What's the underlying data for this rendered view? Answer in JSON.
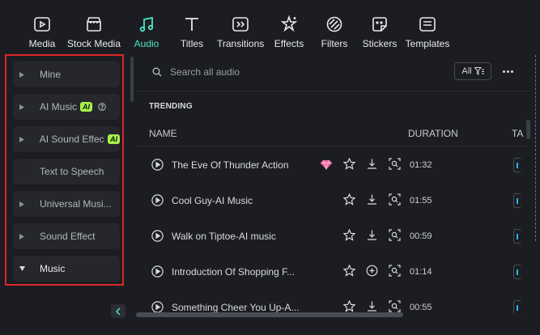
{
  "toolbar": {
    "items": [
      {
        "label": "Media",
        "icon": "media-icon"
      },
      {
        "label": "Stock Media",
        "icon": "stock-media-icon"
      },
      {
        "label": "Audio",
        "icon": "music-note-icon",
        "active": true
      },
      {
        "label": "Titles",
        "icon": "titles-icon"
      },
      {
        "label": "Transitions",
        "icon": "transitions-icon"
      },
      {
        "label": "Effects",
        "icon": "effects-icon"
      },
      {
        "label": "Filters",
        "icon": "filters-icon"
      },
      {
        "label": "Stickers",
        "icon": "stickers-icon"
      },
      {
        "label": "Templates",
        "icon": "templates-icon"
      }
    ],
    "accent": "#4fe3c8"
  },
  "sidebar": {
    "items": [
      {
        "label": "Mine"
      },
      {
        "label": "AI Music",
        "badge": "AI"
      },
      {
        "label": "AI Sound Effect",
        "badge": "AI"
      },
      {
        "label": "Text to Speech"
      },
      {
        "label": "Universal Musi..."
      },
      {
        "label": "Sound Effect"
      },
      {
        "label": "Music"
      }
    ],
    "selection_color": "#e0242b"
  },
  "search": {
    "placeholder": "Search all audio"
  },
  "filter": {
    "label": "All"
  },
  "section": {
    "title": "TRENDING"
  },
  "table": {
    "headers": {
      "name": "NAME",
      "duration": "DURATION",
      "tag": "TA"
    },
    "rows": [
      {
        "name": "The Eve Of Thunder Action",
        "duration": "01:32",
        "premium": true,
        "action": "download"
      },
      {
        "name": "Cool Guy-AI Music",
        "duration": "01:55",
        "premium": false,
        "action": "download"
      },
      {
        "name": "Walk on Tiptoe-AI music",
        "duration": "00:59",
        "premium": false,
        "action": "download"
      },
      {
        "name": "Introduction Of Shopping F...",
        "duration": "01:14",
        "premium": false,
        "action": "add"
      },
      {
        "name": "Something Cheer You Up-A...",
        "duration": "00:55",
        "premium": false,
        "action": "download"
      }
    ]
  }
}
